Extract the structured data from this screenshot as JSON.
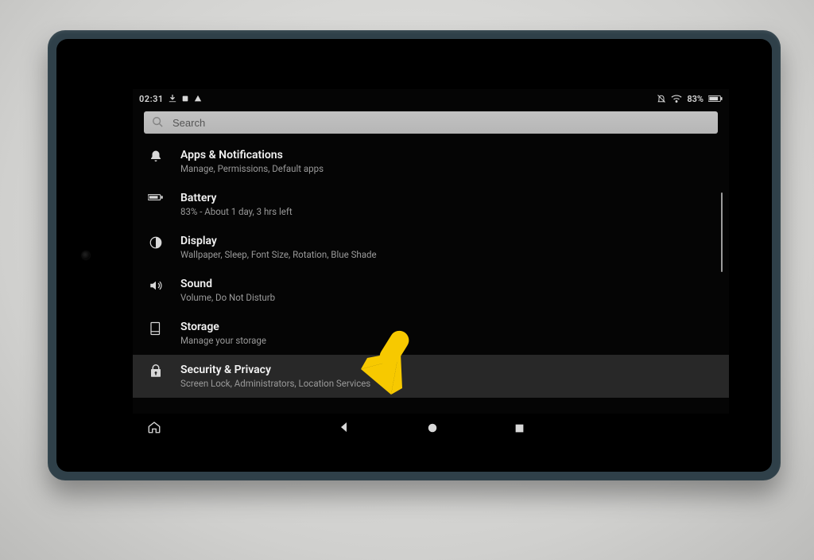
{
  "statusbar": {
    "clock": "02:31",
    "battery_text": "83%"
  },
  "search": {
    "placeholder": "Search",
    "value": ""
  },
  "items": [
    {
      "icon": "bell",
      "title": "Apps & Notifications",
      "subtitle": "Manage, Permissions, Default apps",
      "selected": false
    },
    {
      "icon": "battery",
      "title": "Battery",
      "subtitle": "83% - About 1 day, 3 hrs left",
      "selected": false
    },
    {
      "icon": "contrast",
      "title": "Display",
      "subtitle": "Wallpaper, Sleep, Font Size, Rotation, Blue Shade",
      "selected": false
    },
    {
      "icon": "speaker",
      "title": "Sound",
      "subtitle": "Volume, Do Not Disturb",
      "selected": false
    },
    {
      "icon": "storage",
      "title": "Storage",
      "subtitle": "Manage your storage",
      "selected": false
    },
    {
      "icon": "lock-bag",
      "title": "Security & Privacy",
      "subtitle": "Screen Lock, Administrators, Location Services",
      "selected": true
    }
  ]
}
